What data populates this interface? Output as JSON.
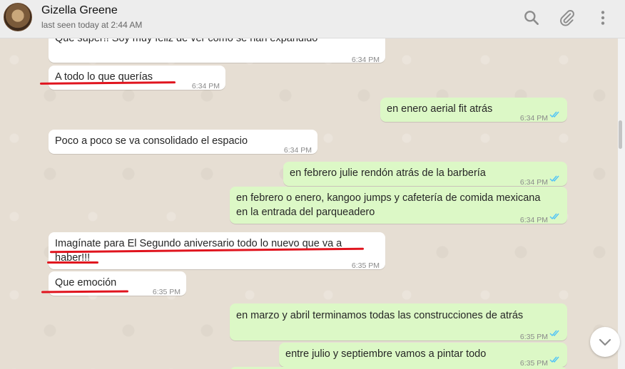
{
  "header": {
    "contact_name": "Gizella Greene",
    "last_seen": "last seen today at 2:44 AM",
    "icons": [
      "search-icon",
      "attach-icon",
      "menu-icon"
    ]
  },
  "messages": [
    {
      "dir": "in",
      "text": "Que súper!! Soy muy feliz de ver cómo se han expandido",
      "time": "6:34 PM"
    },
    {
      "dir": "in",
      "text": "A todo lo que querías",
      "time": "6:34 PM"
    },
    {
      "dir": "out",
      "text": "en enero aerial fit atrás",
      "time": "6:34 PM"
    },
    {
      "dir": "in",
      "text": "Poco a poco se va consolidado el espacio",
      "time": "6:34 PM"
    },
    {
      "dir": "out",
      "text": "en febrero julie rendón atrás de la barbería",
      "time": "6:34 PM"
    },
    {
      "dir": "out",
      "text": "en febrero o enero, kangoo jumps y cafetería de comida mexicana",
      "text2": "en la entrada del parqueadero",
      "time": "6:34 PM"
    },
    {
      "dir": "in",
      "text": "Imagínate para El Segundo aniversario todo lo nuevo que va a",
      "text2": "haber!!!",
      "time": "6:35 PM"
    },
    {
      "dir": "in",
      "text": "Que emoción",
      "time": "6:35 PM"
    },
    {
      "dir": "out",
      "text": "en marzo y abril terminamos todas las construcciones de atrás",
      "time": "6:35 PM"
    },
    {
      "dir": "out",
      "text": "entre julio y septiembre vamos a pintar todo",
      "time": "6:35 PM"
    }
  ],
  "colors": {
    "incoming": "#ffffff",
    "outgoing": "#dcf8c6",
    "read_ticks": "#4fc3f7",
    "annotation": "#e0141e"
  }
}
